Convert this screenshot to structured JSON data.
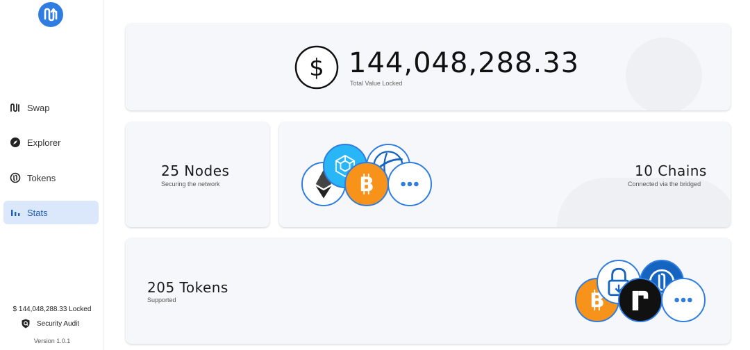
{
  "sidebar": {
    "items": [
      {
        "label": "Swap",
        "icon": "swap-icon",
        "active": false
      },
      {
        "label": "Explorer",
        "icon": "compass-icon",
        "active": false
      },
      {
        "label": "Tokens",
        "icon": "tokens-icon",
        "active": false
      },
      {
        "label": "Stats",
        "icon": "bar-chart-icon",
        "active": true
      }
    ],
    "locked_text": "$ 144,048,288.33 Locked",
    "audit_label": "Security Audit",
    "version": "Version 1.0.1"
  },
  "tvl": {
    "value": "144,048,288.33",
    "label": "Total Value Locked",
    "icon": "dollar-icon"
  },
  "nodes": {
    "title": "25 Nodes",
    "subtitle": "Securing the network"
  },
  "chains": {
    "title": "10 Chains",
    "subtitle": "Connected via the bridged",
    "more_glyph": "•••"
  },
  "tokens": {
    "title": "205 Tokens",
    "subtitle": "Supported",
    "more_glyph": "•••"
  },
  "colors": {
    "accent": "#2f7de1",
    "active_bg": "#dbe8fb",
    "card_bg": "#f6f7fa",
    "bitcoin": "#f7931a"
  }
}
